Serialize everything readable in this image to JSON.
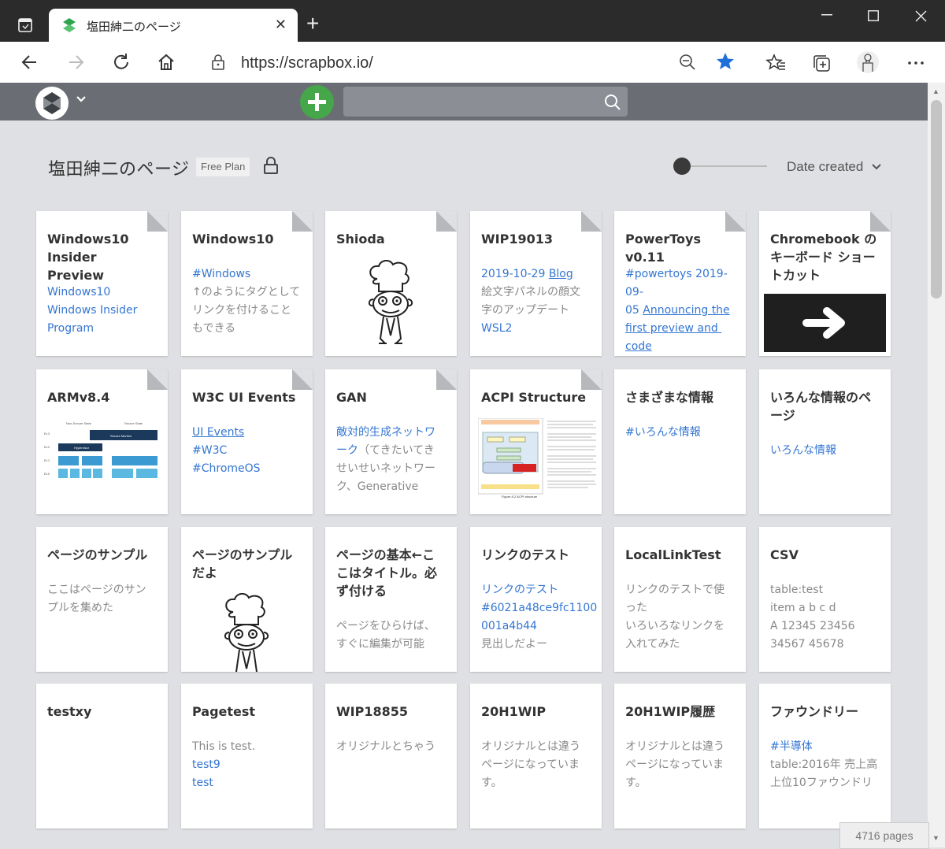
{
  "browser": {
    "tab_title": "塩田紳二のページ",
    "url": "https://scrapbox.io/",
    "close_symbol": "✕",
    "newtab_symbol": "+",
    "icons": [
      "back-arrow-icon",
      "forward-arrow-icon",
      "reload-icon",
      "home-icon",
      "lock-icon",
      "zoom-out-icon",
      "star-icon",
      "favorites-icon",
      "collections-icon",
      "profile-icon",
      "more-icon"
    ]
  },
  "project": {
    "title": "塩田紳二のページ",
    "plan": "Free Plan",
    "sort_label": "Date created"
  },
  "footer": {
    "pages_count": "4716 pages"
  },
  "cards": [
    {
      "title": "Windows10 Insider Preview",
      "dog": true,
      "lines": [
        [
          {
            "t": "Windows10",
            "c": "lk"
          }
        ],
        [
          {
            "t": "Windows Insider",
            "c": "lk"
          }
        ],
        [
          {
            "t": "Program",
            "c": "lk"
          }
        ]
      ]
    },
    {
      "title": "Windows10",
      "dog": true,
      "lines": [
        [
          {
            "t": "#Windows",
            "c": "lk"
          }
        ],
        [
          {
            "t": "↑のようにタグとして",
            "c": ""
          }
        ],
        [
          {
            "t": "リンクを付けること",
            "c": ""
          }
        ],
        [
          {
            "t": "もできる",
            "c": ""
          }
        ]
      ]
    },
    {
      "title": "Shioda",
      "dog": true,
      "image": "chef-icon",
      "lines": []
    },
    {
      "title": "WIP19013",
      "dog": true,
      "lines": [
        [
          {
            "t": "2019-10-29 ",
            "c": "lk"
          },
          {
            "t": "Blog",
            "c": "lk ul"
          }
        ],
        [
          {
            "t": "絵文字パネルの顔文",
            "c": ""
          }
        ],
        [
          {
            "t": "字のアップデート",
            "c": ""
          }
        ],
        [
          {
            "t": "WSL2",
            "c": "lk"
          }
        ]
      ]
    },
    {
      "title": "PowerToys v0.11",
      "dog": true,
      "lines": [
        [
          {
            "t": "#powertoys 2019-09-",
            "c": "lk"
          }
        ],
        [
          {
            "t": "05 ",
            "c": "lk"
          },
          {
            "t": "Announcing the",
            "c": "lk ul"
          }
        ],
        [
          {
            "t": "first preview and code",
            "c": "lk ul"
          }
        ]
      ]
    },
    {
      "title": "Chromebook のキーボード ショートカット",
      "dog": true,
      "image": "arrow-key-icon",
      "lines": []
    },
    {
      "title": "ARMv8.4",
      "dog": true,
      "image": "arm-diagram",
      "lines": []
    },
    {
      "title": "W3C UI Events",
      "dog": true,
      "lines": [
        [
          {
            "t": "UI Events",
            "c": "lk ul"
          }
        ],
        [
          {
            "t": "#W3C",
            "c": "lk"
          }
        ],
        [
          {
            "t": "#ChromeOS",
            "c": "lk"
          }
        ]
      ]
    },
    {
      "title": "GAN",
      "dog": true,
      "lines": [
        [
          {
            "t": "敵対的生成ネットワ",
            "c": "lk"
          }
        ],
        [
          {
            "t": "ーク",
            "c": "lk"
          },
          {
            "t": "（てきたいてき",
            "c": ""
          }
        ],
        [
          {
            "t": "せいせいネットワー",
            "c": ""
          }
        ],
        [
          {
            "t": "ク、Generative",
            "c": ""
          }
        ]
      ]
    },
    {
      "title": "ACPI Structure",
      "dog": true,
      "image": "acpi-diagram",
      "lines": []
    },
    {
      "title": "さまざまな情報",
      "dog": false,
      "lines": [
        [
          {
            "t": "#いろんな情報",
            "c": "lk"
          }
        ]
      ]
    },
    {
      "title": "いろんな情報のページ",
      "dog": false,
      "lines": [
        [
          {
            "t": "いろんな情報",
            "c": "lk"
          }
        ]
      ]
    },
    {
      "title": "ページのサンプル",
      "dog": false,
      "lines": [
        [
          {
            "t": "ここはページのサン",
            "c": ""
          }
        ],
        [
          {
            "t": "プルを集めた",
            "c": ""
          }
        ]
      ]
    },
    {
      "title": "ページのサンプルだよ",
      "dog": false,
      "image": "chef-icon",
      "lines": []
    },
    {
      "title": "ページの基本←ここはタイトル。必ず付ける",
      "dog": false,
      "lines": [
        [
          {
            "t": "ページをひらけば、",
            "c": ""
          }
        ],
        [
          {
            "t": "すぐに編集が可能",
            "c": ""
          }
        ]
      ]
    },
    {
      "title": "リンクのテスト",
      "dog": false,
      "lines": [
        [
          {
            "t": "リンクのテスト",
            "c": "lk"
          }
        ],
        [
          {
            "t": "#6021a48ce9fc1100",
            "c": "lk"
          }
        ],
        [
          {
            "t": "001a4b44",
            "c": "lk"
          }
        ],
        [
          {
            "t": "見出しだよー",
            "c": ""
          }
        ]
      ]
    },
    {
      "title": "LocalLinkTest",
      "dog": false,
      "lines": [
        [
          {
            "t": "リンクのテストで使",
            "c": ""
          }
        ],
        [
          {
            "t": "った",
            "c": ""
          }
        ],
        [
          {
            "t": "いろいろなリンクを",
            "c": ""
          }
        ],
        [
          {
            "t": "入れてみた",
            "c": ""
          }
        ]
      ]
    },
    {
      "title": "CSV",
      "dog": false,
      "lines": [
        [
          {
            "t": "table:test",
            "c": ""
          }
        ],
        [
          {
            "t": "item a b c d",
            "c": ""
          }
        ],
        [
          {
            "t": "A 12345 23456",
            "c": ""
          }
        ],
        [
          {
            "t": "34567 45678",
            "c": ""
          }
        ]
      ]
    },
    {
      "title": "testxy",
      "dog": false,
      "lines": []
    },
    {
      "title": "Pagetest",
      "dog": false,
      "lines": [
        [
          {
            "t": "This is test.",
            "c": ""
          }
        ],
        [
          {
            "t": "test9",
            "c": "lk"
          }
        ],
        [
          {
            "t": "test",
            "c": "lk"
          }
        ]
      ]
    },
    {
      "title": "WIP18855",
      "dog": false,
      "lines": [
        [
          {
            "t": "オリジナルとちゃう",
            "c": ""
          }
        ]
      ]
    },
    {
      "title": "20H1WIP",
      "dog": false,
      "lines": [
        [
          {
            "t": "オリジナルとは違う",
            "c": ""
          }
        ],
        [
          {
            "t": "ページになっていま",
            "c": ""
          }
        ],
        [
          {
            "t": "す。",
            "c": ""
          }
        ]
      ]
    },
    {
      "title": "20H1WIP履歴",
      "dog": false,
      "lines": [
        [
          {
            "t": "オリジナルとは違う",
            "c": ""
          }
        ],
        [
          {
            "t": "ページになっていま",
            "c": ""
          }
        ],
        [
          {
            "t": "す。",
            "c": ""
          }
        ]
      ]
    },
    {
      "title": "ファウンドリー",
      "dog": false,
      "lines": [
        [
          {
            "t": "#半導体",
            "c": "lk"
          }
        ],
        [
          {
            "t": "table:2016年 売上高",
            "c": ""
          }
        ],
        [
          {
            "t": "上位10ファウンドリ",
            "c": ""
          }
        ]
      ]
    }
  ]
}
